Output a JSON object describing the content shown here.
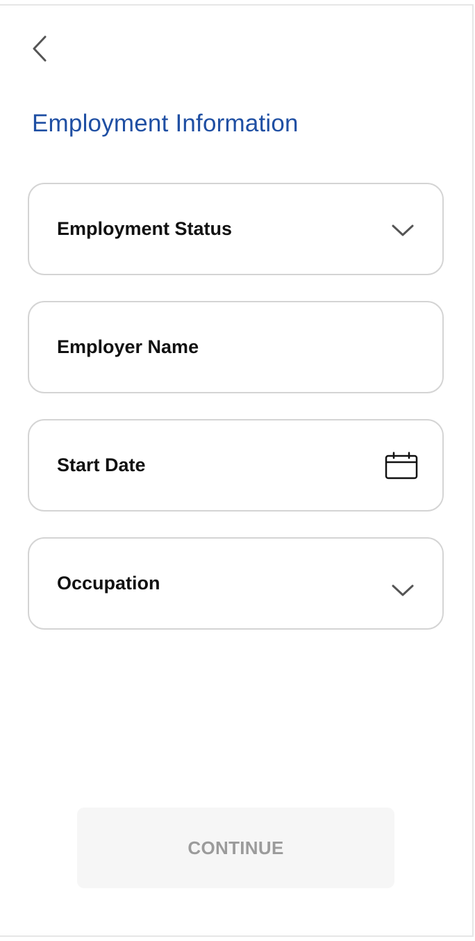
{
  "header": {
    "back_icon": "chevron-left-icon",
    "title": "Employment Information"
  },
  "form": {
    "fields": [
      {
        "label": "Employment Status",
        "icon": "chevron-down-icon",
        "type": "select"
      },
      {
        "label": "Employer Name",
        "icon": "",
        "type": "text"
      },
      {
        "label": "Start Date",
        "icon": "calendar-icon",
        "type": "date"
      },
      {
        "label": "Occupation",
        "icon": "chevron-down-icon",
        "type": "select"
      }
    ]
  },
  "footer": {
    "continue_label": "CONTINUE",
    "continue_enabled": false
  },
  "colors": {
    "title": "#1f4fa3",
    "field_border": "#d4d4d4",
    "button_disabled_bg": "#f6f6f6",
    "button_disabled_text": "#9b9b9b"
  }
}
